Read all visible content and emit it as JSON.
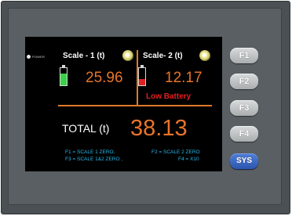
{
  "power": {
    "label": "POWER"
  },
  "scale1": {
    "title": "Scale - 1 (t)",
    "value": "25.96",
    "battery_level": 0.7,
    "battery_color": "#3bd14a"
  },
  "scale2": {
    "title": "Scale- 2 (t)",
    "value": "12.17",
    "battery_level": 0.35,
    "battery_color": "#e02020",
    "warning": "Low Battery"
  },
  "total": {
    "label": "TOTAL (t)",
    "value": "38.13"
  },
  "help": {
    "line1_left": "F1 = SCALE 1 ZERO.",
    "line1_right": "F2 = SCALE 2 ZERO",
    "line2_left": "F3 = SCALE 1&2 ZERO ,",
    "line2_right": "F4 = X10"
  },
  "buttons": {
    "f1": "F1",
    "f2": "F2",
    "f3": "F3",
    "f4": "F4",
    "sys": "SYS"
  },
  "colors": {
    "accent_orange": "#e8742a",
    "help_text": "#29b8e8",
    "sys_button": "#3a6cc8"
  },
  "icons": {
    "indicator": "status-light-icon",
    "battery": "battery-icon"
  }
}
